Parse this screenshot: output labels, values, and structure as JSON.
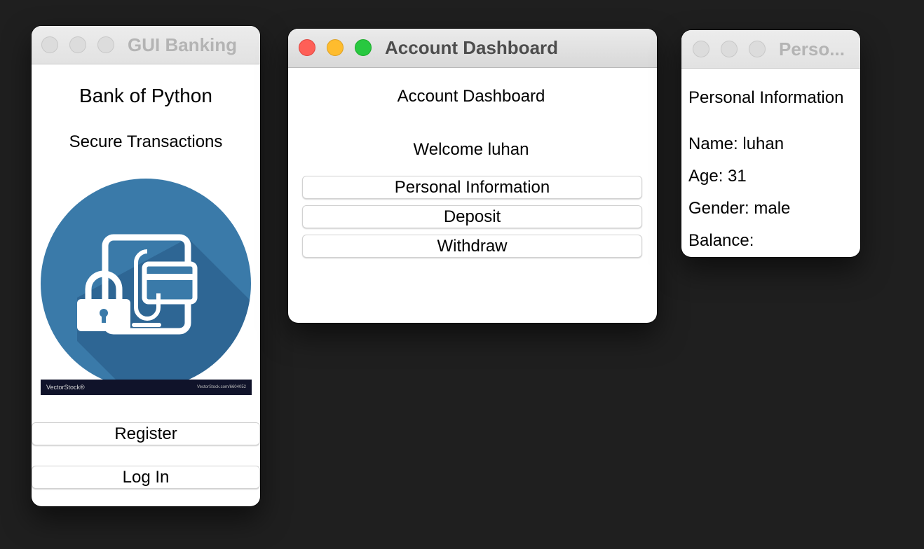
{
  "banking_window": {
    "title": "GUI Banking",
    "heading": "Bank of Python",
    "subheading": "Secure Transactions",
    "logo": {
      "icon": "secure-payment-icon",
      "circle_color": "#3a7aa9",
      "shadow_color": "#2d6390",
      "watermark_left": "VectorStock®",
      "watermark_right": "VectorStock.com/6604052"
    },
    "register_label": "Register",
    "login_label": "Log In"
  },
  "dashboard_window": {
    "title": "Account Dashboard",
    "heading": "Account Dashboard",
    "welcome": "Welcome luhan",
    "buttons": {
      "personal_info": "Personal Information",
      "deposit": "Deposit",
      "withdraw": "Withdraw"
    }
  },
  "personal_window": {
    "title": "Perso...",
    "heading": "Personal Information",
    "name": "Name: luhan",
    "age": "Age: 31",
    "gender": "Gender: male",
    "balance": "Balance:"
  },
  "colors": {
    "desktop": "#1f1f1f",
    "close": "#fe5f57",
    "minimize": "#febc2e",
    "maximize": "#28c840"
  }
}
